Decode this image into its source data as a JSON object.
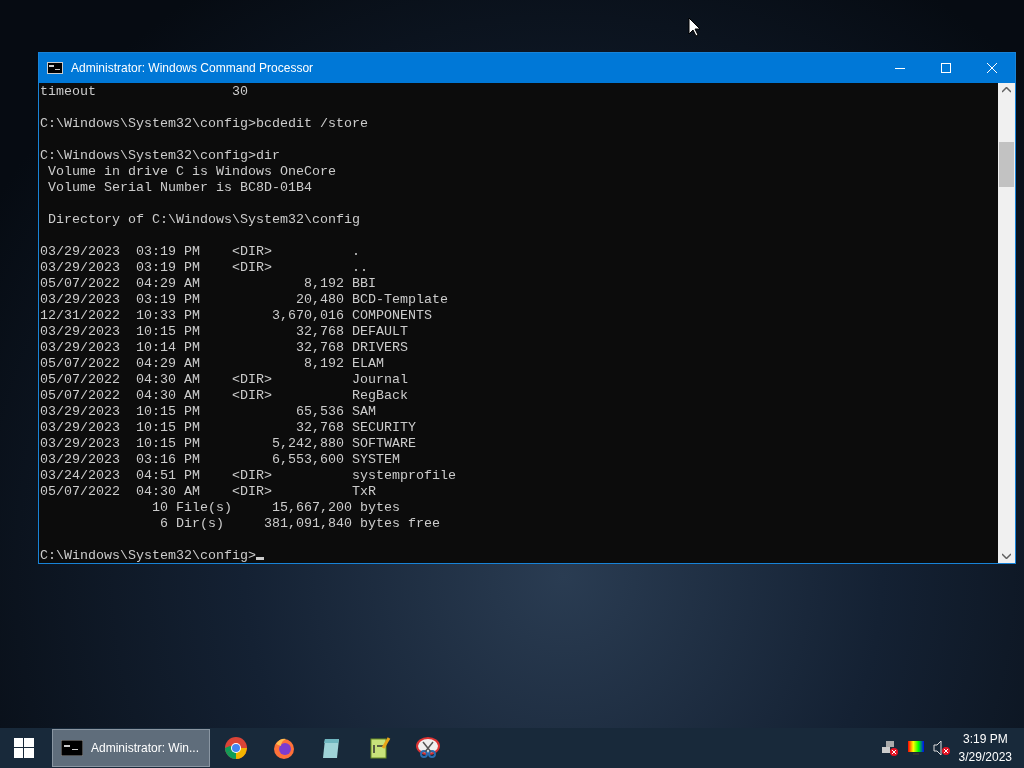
{
  "window": {
    "title": "Administrator: Windows Command Processor"
  },
  "console": {
    "lines": [
      {
        "text": "timeout                 30"
      },
      {
        "kind": "blank"
      },
      {
        "text": "C:\\Windows\\System32\\config>bcdedit /store"
      },
      {
        "kind": "blank"
      },
      {
        "text": "C:\\Windows\\System32\\config>dir"
      },
      {
        "text": " Volume in drive C is Windows OneCore"
      },
      {
        "text": " Volume Serial Number is BC8D-01B4"
      },
      {
        "kind": "blank"
      },
      {
        "text": " Directory of C:\\Windows\\System32\\config"
      },
      {
        "kind": "blank"
      },
      {
        "text": "03/29/2023  03:19 PM    <DIR>          ."
      },
      {
        "text": "03/29/2023  03:19 PM    <DIR>          .."
      },
      {
        "text": "05/07/2022  04:29 AM             8,192 BBI"
      },
      {
        "text": "03/29/2023  03:19 PM            20,480 BCD-Template"
      },
      {
        "text": "12/31/2022  10:33 PM         3,670,016 COMPONENTS"
      },
      {
        "text": "03/29/2023  10:15 PM            32,768 DEFAULT"
      },
      {
        "text": "03/29/2023  10:14 PM            32,768 DRIVERS"
      },
      {
        "text": "05/07/2022  04:29 AM             8,192 ELAM"
      },
      {
        "text": "05/07/2022  04:30 AM    <DIR>          Journal"
      },
      {
        "text": "05/07/2022  04:30 AM    <DIR>          RegBack"
      },
      {
        "text": "03/29/2023  10:15 PM            65,536 SAM"
      },
      {
        "text": "03/29/2023  10:15 PM            32,768 SECURITY"
      },
      {
        "text": "03/29/2023  10:15 PM         5,242,880 SOFTWARE"
      },
      {
        "text": "03/29/2023  03:16 PM         6,553,600 SYSTEM"
      },
      {
        "text": "03/24/2023  04:51 PM    <DIR>          systemprofile"
      },
      {
        "text": "05/07/2022  04:30 AM    <DIR>          TxR"
      },
      {
        "text": "              10 File(s)     15,667,200 bytes"
      },
      {
        "text": "               6 Dir(s)     381,091,840 bytes free"
      },
      {
        "kind": "blank"
      },
      {
        "text": "C:\\Windows\\System32\\config>",
        "kind": "prompt"
      }
    ]
  },
  "taskbar": {
    "items": [
      {
        "kind": "start"
      },
      {
        "kind": "window",
        "label": "Administrator: Win...",
        "selected": true
      },
      {
        "kind": "chrome"
      },
      {
        "kind": "firefox"
      },
      {
        "kind": "notepad"
      },
      {
        "kind": "notepadpp"
      },
      {
        "kind": "snip"
      }
    ],
    "tray": {
      "time": "3:19 PM",
      "date": "3/29/2023"
    }
  }
}
